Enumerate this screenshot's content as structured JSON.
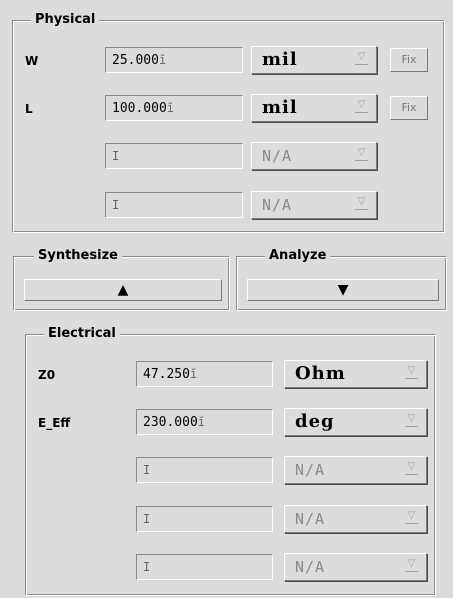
{
  "physical": {
    "legend": "Physical",
    "rows": [
      {
        "label": "W",
        "value": "25.000",
        "unit": "mil",
        "fix": "Fix"
      },
      {
        "label": "L",
        "value": "100.000",
        "unit": "mil",
        "fix": "Fix"
      },
      {
        "label": "",
        "value": "",
        "unit": "N/A"
      },
      {
        "label": "",
        "value": "",
        "unit": "N/A"
      }
    ]
  },
  "synthesize": {
    "legend": "Synthesize",
    "icon": "arrow-up-icon",
    "glyph": "▲"
  },
  "analyze": {
    "legend": "Analyze",
    "icon": "arrow-down-icon",
    "glyph": "▼"
  },
  "electrical": {
    "legend": "Electrical",
    "rows": [
      {
        "label": "Z0",
        "value": "47.250",
        "unit": "Ohm"
      },
      {
        "label": "E_Eff",
        "value": "230.000",
        "unit": "deg"
      },
      {
        "label": "",
        "value": "",
        "unit": "N/A"
      },
      {
        "label": "",
        "value": "",
        "unit": "N/A"
      },
      {
        "label": "",
        "value": "",
        "unit": "N/A"
      }
    ]
  },
  "colors": {
    "background": "#dcdcdc",
    "disabled_text": "#8a8a8a"
  }
}
